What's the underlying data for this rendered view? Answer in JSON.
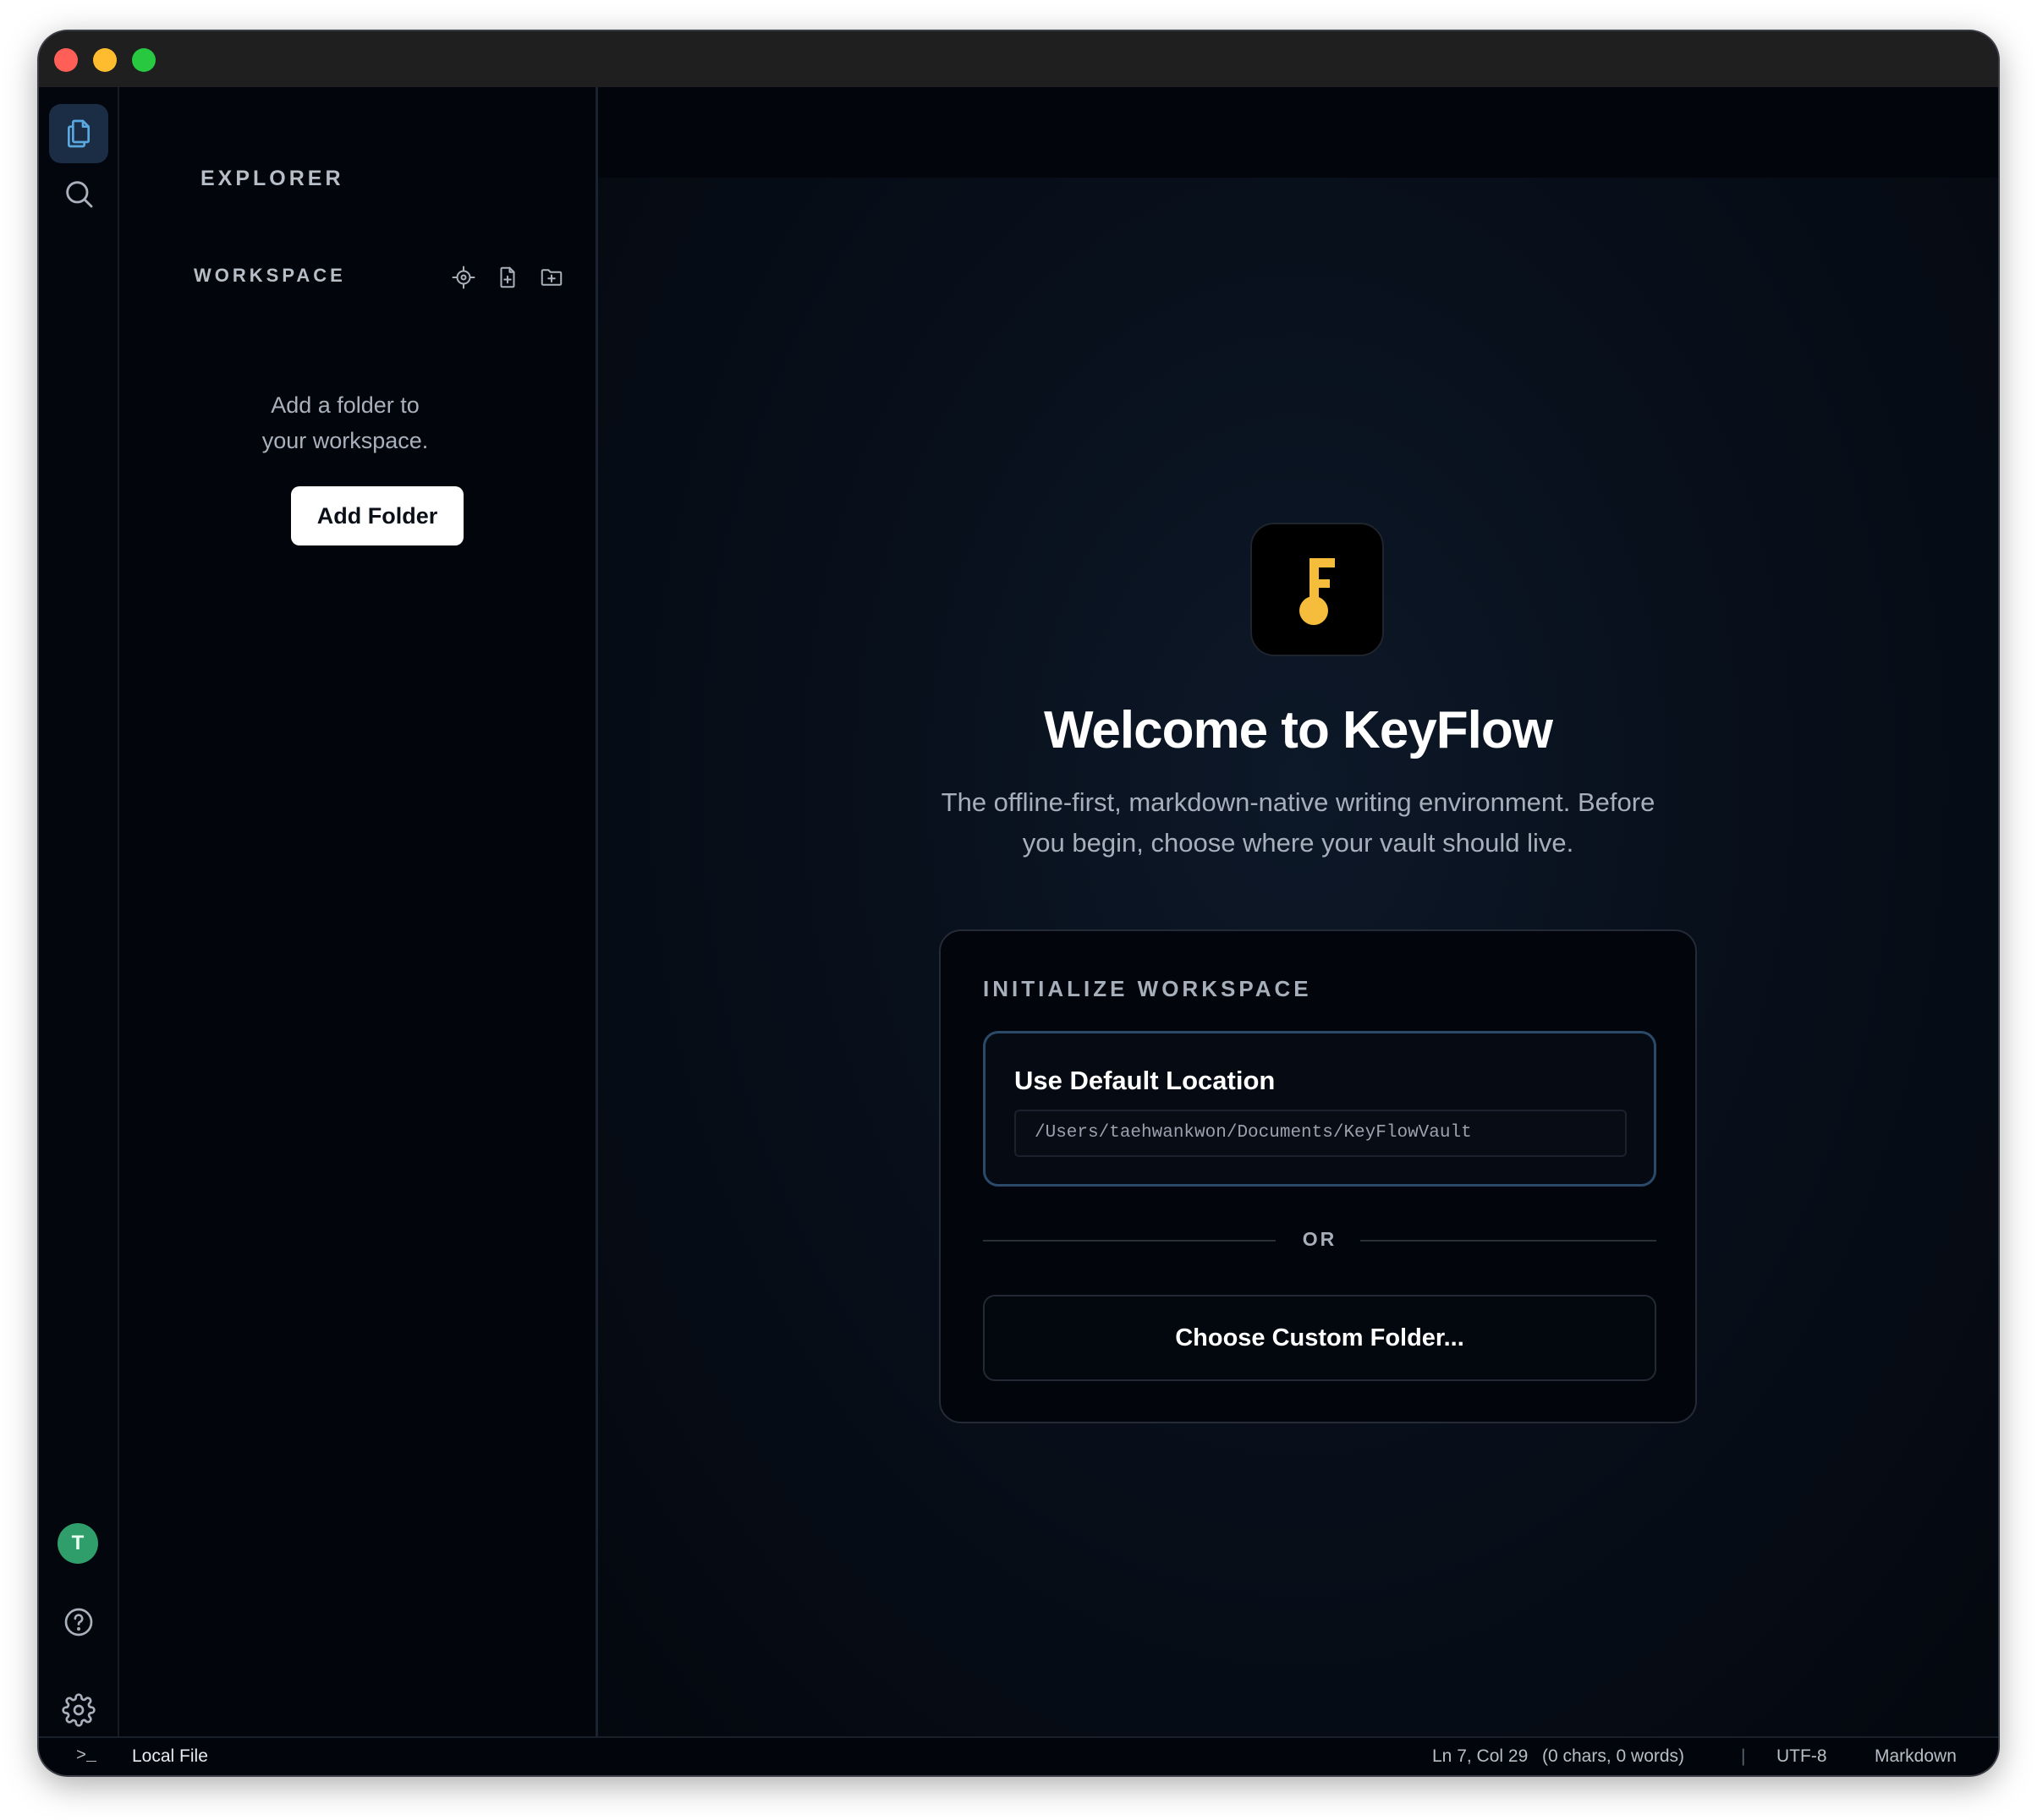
{
  "window": {
    "traffic_lights": [
      "close",
      "minimize",
      "zoom"
    ]
  },
  "activity_bar": {
    "items": [
      {
        "name": "explorer",
        "icon": "files-icon",
        "active": true
      },
      {
        "name": "search",
        "icon": "search-icon",
        "active": false
      }
    ],
    "avatar_initial": "T",
    "bottom_items": [
      {
        "name": "help",
        "icon": "help-circle-icon"
      },
      {
        "name": "settings",
        "icon": "gear-icon"
      }
    ]
  },
  "explorer": {
    "title": "EXPLORER",
    "workspace_label": "WORKSPACE",
    "workspace_actions": [
      "locate-icon",
      "new-file-icon",
      "new-folder-icon"
    ],
    "empty_message": "Add a folder to your workspace.",
    "add_folder_label": "Add Folder"
  },
  "main": {
    "logo_letter": "F",
    "welcome_title": "Welcome to KeyFlow",
    "subtitle": "The offline-first, markdown-native writing environment. Before you begin, choose where your vault should live.",
    "card": {
      "title": "INITIALIZE WORKSPACE",
      "default_title": "Use Default Location",
      "default_path": "/Users/taehwankwon/Documents/KeyFlowVault",
      "divider_text": "OR",
      "custom_button_label": "Choose Custom Folder..."
    }
  },
  "statusbar": {
    "terminal_glyph": ">_",
    "source": "Local File",
    "cursor": "Ln 7, Col 29",
    "counts": "(0 chars, 0 words)",
    "separator": "|",
    "encoding": "UTF-8",
    "language": "Markdown"
  },
  "colors": {
    "accent_blue": "#4f9fd8",
    "logo_yellow": "#f5bd3b",
    "avatar_green": "#2f9e6a"
  }
}
